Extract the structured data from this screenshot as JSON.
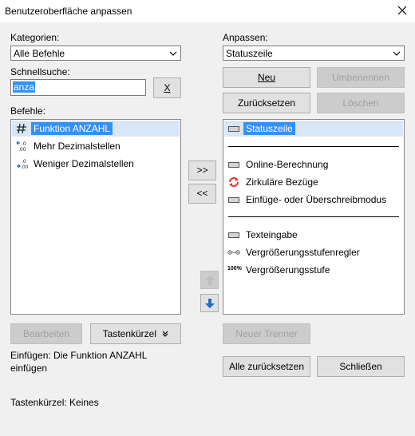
{
  "window": {
    "title": "Benutzeroberfläche anpassen",
    "close_label": "✕"
  },
  "left": {
    "categories_label": "Kategorien:",
    "categories_value": "Alle Befehle",
    "quicksearch_label": "Schnellsuche:",
    "quicksearch_value": "anza",
    "clear_label": "X",
    "commands_label": "Befehle:",
    "commands": [
      {
        "label": "Funktion ANZAHL",
        "icon": "hash-icon"
      },
      {
        "label": "Mehr Dezimalstellen",
        "icon": "increase-decimals-icon"
      },
      {
        "label": "Weniger Dezimalstellen",
        "icon": "decrease-decimals-icon"
      }
    ],
    "edit_label": "Bearbeiten",
    "shortcut_label": "Tastenkürzel",
    "description": "Einfügen: Die Funktion ANZAHL einfügen",
    "shortcut_info": "Tastenkürzel: Keines"
  },
  "middle": {
    "add_label": ">>",
    "remove_label": "<<",
    "up_icon": "arrow-up-icon",
    "down_icon": "arrow-down-icon"
  },
  "right": {
    "customize_label": "Anpassen:",
    "customize_value": "Statuszeile",
    "new_label": "Neu",
    "rename_label": "Umbenennen",
    "reset_label": "Zurücksetzen",
    "delete_label": "Löschen",
    "items": [
      {
        "label": "Statuszeile",
        "icon": "statusbar-icon"
      },
      {
        "label": "Online-Berechnung",
        "icon": "statusbar-icon"
      },
      {
        "label": "Zirkuläre Bezüge",
        "icon": "circular-refs-icon"
      },
      {
        "label": "Einfüge- oder Überschreibmodus",
        "icon": "statusbar-icon"
      },
      {
        "label": "Texteingabe",
        "icon": "statusbar-icon"
      },
      {
        "label": "Vergrößerungsstufenregler",
        "icon": "zoom-slider-icon"
      },
      {
        "label": "Vergrößerungsstufe",
        "icon": "zoom-percent-icon",
        "icon_text": "100%"
      }
    ],
    "new_separator_label": "Neuer Trenner",
    "reset_all_label": "Alle zurücksetzen",
    "close_label": "Schließen"
  },
  "colors": {
    "selection": "#3391f4",
    "selection_row": "#d9e6f5",
    "arrow_blue": "#1f6fc5",
    "circular_red": "#e0392b"
  }
}
